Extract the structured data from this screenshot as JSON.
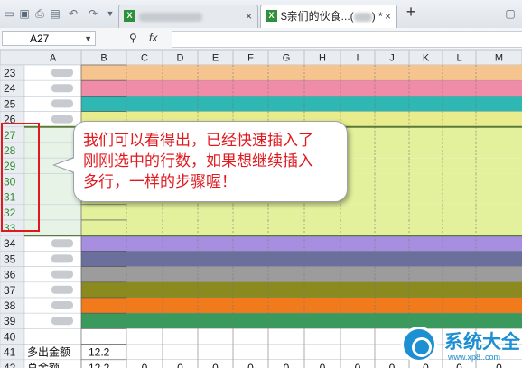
{
  "toolbar": {
    "tabs": [
      {
        "title": "",
        "active": false,
        "blurred": true
      },
      {
        "title": "$亲们的伙食...(",
        "suffix": ") *",
        "active": true,
        "blurred": false
      }
    ],
    "new_tab_symbol": "+"
  },
  "formula_bar": {
    "name_box": "A27",
    "fx_label": "fx",
    "zoom_icon": "zoom-icon"
  },
  "sheet": {
    "columns": [
      "A",
      "B",
      "C",
      "D",
      "E",
      "F",
      "G",
      "H",
      "I",
      "J",
      "K",
      "L",
      "M"
    ],
    "rows": [
      {
        "n": "23",
        "a": "",
        "b": "",
        "band": "#f6c48f",
        "blurA": true
      },
      {
        "n": "24",
        "a": "",
        "b": "",
        "band": "#ef8ca8",
        "blurA": true
      },
      {
        "n": "25",
        "a": "",
        "b": "",
        "band": "#2fb7b3",
        "blurA": true
      },
      {
        "n": "26",
        "a": "",
        "b": "",
        "band": "#e8ec8d",
        "blurA": true
      },
      {
        "n": "27",
        "a": "",
        "b": "",
        "band": "#e4f19c",
        "blurA": false
      },
      {
        "n": "28",
        "a": "",
        "b": "",
        "band": "#e4f19c",
        "blurA": false
      },
      {
        "n": "29",
        "a": "",
        "b": "",
        "band": "#e4f19c",
        "blurA": false
      },
      {
        "n": "30",
        "a": "",
        "b": "",
        "band": "#e4f19c",
        "blurA": false
      },
      {
        "n": "31",
        "a": "",
        "b": "",
        "band": "#e4f19c",
        "blurA": false
      },
      {
        "n": "32",
        "a": "",
        "b": "",
        "band": "#e4f19c",
        "blurA": false
      },
      {
        "n": "33",
        "a": "",
        "b": "",
        "band": "#e4f19c",
        "blurA": false
      },
      {
        "n": "34",
        "a": "",
        "b": "",
        "band": "#a88ee0",
        "blurA": true
      },
      {
        "n": "35",
        "a": "",
        "b": "",
        "band": "#6b6f9c",
        "blurA": true
      },
      {
        "n": "36",
        "a": "",
        "b": "",
        "band": "#9c9c9c",
        "blurA": true
      },
      {
        "n": "37",
        "a": "",
        "b": "",
        "band": "#8a8a1e",
        "blurA": true
      },
      {
        "n": "38",
        "a": "",
        "b": "",
        "band": "#f07a1c",
        "blurA": true
      },
      {
        "n": "39",
        "a": "",
        "b": "",
        "band": "#3a9a5e",
        "blurA": true
      },
      {
        "n": "40",
        "a": "",
        "b": "",
        "band": "#ffffff",
        "blurA": false
      },
      {
        "n": "41",
        "a": "多出金额",
        "b": "12.2",
        "band": "#ffffff",
        "blurA": false
      },
      {
        "n": "42",
        "a": "总金额",
        "b": "12.2",
        "band": "#ffffff",
        "blurA": false,
        "zeros": true
      }
    ],
    "zero_value": "0",
    "inserted_row_color": "#e4f19c",
    "selection_color": "#e0191e"
  },
  "callout": {
    "line1": "我们可以看得出，已经快速插入了",
    "line2": "刚刚选中的行数，如果想继续插入",
    "line3": "多行，一样的步骤喔！"
  },
  "watermark": {
    "title": "系统大全",
    "url": "www.xp8..com"
  }
}
